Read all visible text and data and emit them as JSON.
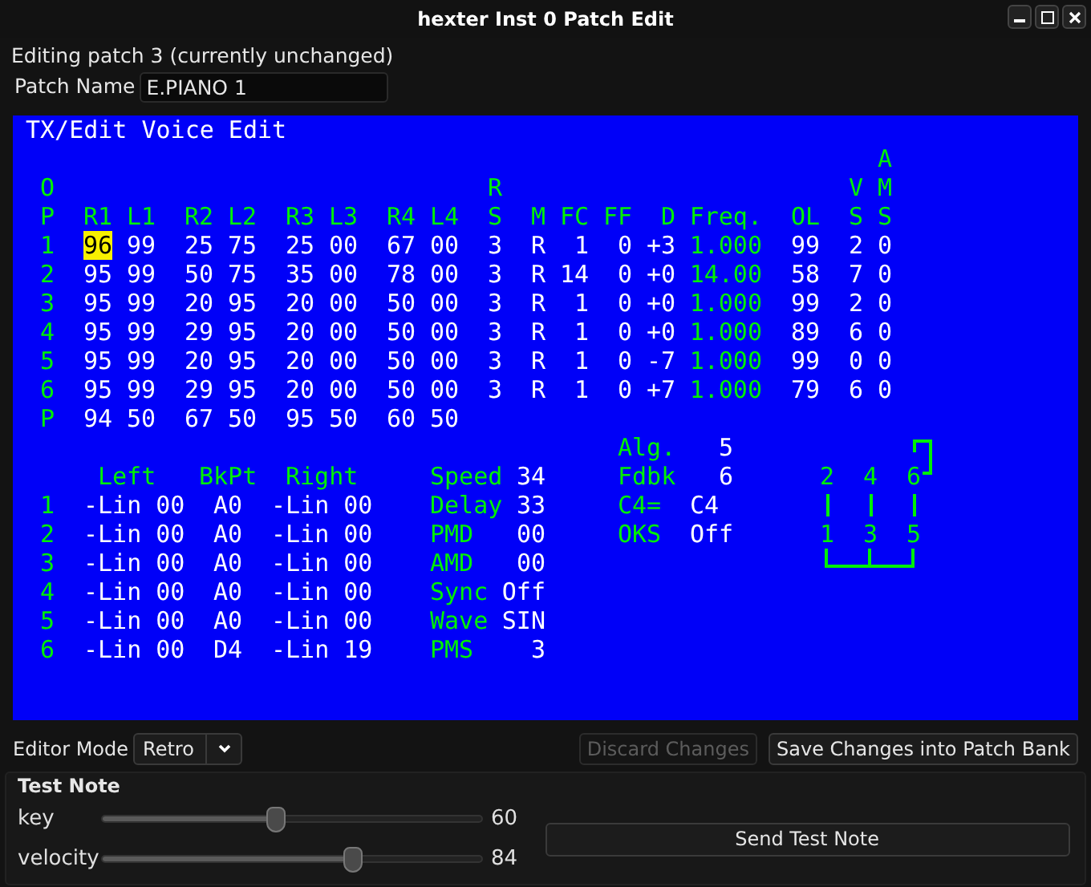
{
  "window": {
    "title": "hexter Inst 0 Patch Edit"
  },
  "status": "Editing patch 3 (currently unchanged)",
  "patch_name": {
    "label": "Patch Name",
    "value": "E.PIANO 1"
  },
  "voice_editor": {
    "title": "TX/Edit Voice Edit",
    "op_columns": [
      {
        "header": [
          "O",
          "P"
        ],
        "kind": "op"
      },
      {
        "header": [
          "R1"
        ],
        "kind": "param"
      },
      {
        "header": [
          "L1"
        ],
        "kind": "param"
      },
      {
        "header": [
          "R2"
        ],
        "kind": "param"
      },
      {
        "header": [
          "L2"
        ],
        "kind": "param"
      },
      {
        "header": [
          "R3"
        ],
        "kind": "param"
      },
      {
        "header": [
          "L3"
        ],
        "kind": "param"
      },
      {
        "header": [
          "R4"
        ],
        "kind": "param"
      },
      {
        "header": [
          "L4"
        ],
        "kind": "param"
      },
      {
        "header": [
          "R",
          "S"
        ],
        "kind": "param"
      },
      {
        "header": [
          "M"
        ],
        "kind": "param"
      },
      {
        "header": [
          "FC"
        ],
        "kind": "param"
      },
      {
        "header": [
          "FF"
        ],
        "kind": "param"
      },
      {
        "header": [
          "D"
        ],
        "kind": "param"
      },
      {
        "header": [
          "Freq."
        ],
        "kind": "freq"
      },
      {
        "header": [
          "OL"
        ],
        "kind": "param"
      },
      {
        "header": [
          "V",
          "S"
        ],
        "kind": "param"
      },
      {
        "header": [
          "A",
          "M",
          "S"
        ],
        "kind": "param"
      }
    ],
    "op_rows": [
      {
        "op": "1",
        "cells": [
          {
            "text": "96",
            "selected": true
          },
          {
            "text": "99",
            "selected": false
          },
          {
            "text": "25",
            "selected": false
          },
          {
            "text": "75",
            "selected": false
          },
          {
            "text": "25",
            "selected": false
          },
          {
            "text": "00",
            "selected": false
          },
          {
            "text": "67",
            "selected": false
          },
          {
            "text": "00",
            "selected": false
          },
          {
            "text": "3",
            "selected": false
          },
          {
            "text": "R",
            "selected": false
          },
          {
            "text": "1",
            "selected": false
          },
          {
            "text": "0",
            "selected": false
          },
          {
            "text": "+3",
            "selected": false
          },
          {
            "text": "1.000",
            "selected": false
          },
          {
            "text": "99",
            "selected": false
          },
          {
            "text": "2",
            "selected": false
          },
          {
            "text": "0",
            "selected": false
          }
        ]
      },
      {
        "op": "2",
        "cells": [
          {
            "text": "95",
            "selected": false
          },
          {
            "text": "99",
            "selected": false
          },
          {
            "text": "50",
            "selected": false
          },
          {
            "text": "75",
            "selected": false
          },
          {
            "text": "35",
            "selected": false
          },
          {
            "text": "00",
            "selected": false
          },
          {
            "text": "78",
            "selected": false
          },
          {
            "text": "00",
            "selected": false
          },
          {
            "text": "3",
            "selected": false
          },
          {
            "text": "R",
            "selected": false
          },
          {
            "text": "14",
            "selected": false
          },
          {
            "text": "0",
            "selected": false
          },
          {
            "text": "+0",
            "selected": false
          },
          {
            "text": "14.00",
            "selected": false
          },
          {
            "text": "58",
            "selected": false
          },
          {
            "text": "7",
            "selected": false
          },
          {
            "text": "0",
            "selected": false
          }
        ]
      },
      {
        "op": "3",
        "cells": [
          {
            "text": "95",
            "selected": false
          },
          {
            "text": "99",
            "selected": false
          },
          {
            "text": "20",
            "selected": false
          },
          {
            "text": "95",
            "selected": false
          },
          {
            "text": "20",
            "selected": false
          },
          {
            "text": "00",
            "selected": false
          },
          {
            "text": "50",
            "selected": false
          },
          {
            "text": "00",
            "selected": false
          },
          {
            "text": "3",
            "selected": false
          },
          {
            "text": "R",
            "selected": false
          },
          {
            "text": "1",
            "selected": false
          },
          {
            "text": "0",
            "selected": false
          },
          {
            "text": "+0",
            "selected": false
          },
          {
            "text": "1.000",
            "selected": false
          },
          {
            "text": "99",
            "selected": false
          },
          {
            "text": "2",
            "selected": false
          },
          {
            "text": "0",
            "selected": false
          }
        ]
      },
      {
        "op": "4",
        "cells": [
          {
            "text": "95",
            "selected": false
          },
          {
            "text": "99",
            "selected": false
          },
          {
            "text": "29",
            "selected": false
          },
          {
            "text": "95",
            "selected": false
          },
          {
            "text": "20",
            "selected": false
          },
          {
            "text": "00",
            "selected": false
          },
          {
            "text": "50",
            "selected": false
          },
          {
            "text": "00",
            "selected": false
          },
          {
            "text": "3",
            "selected": false
          },
          {
            "text": "R",
            "selected": false
          },
          {
            "text": "1",
            "selected": false
          },
          {
            "text": "0",
            "selected": false
          },
          {
            "text": "+0",
            "selected": false
          },
          {
            "text": "1.000",
            "selected": false
          },
          {
            "text": "89",
            "selected": false
          },
          {
            "text": "6",
            "selected": false
          },
          {
            "text": "0",
            "selected": false
          }
        ]
      },
      {
        "op": "5",
        "cells": [
          {
            "text": "95",
            "selected": false
          },
          {
            "text": "99",
            "selected": false
          },
          {
            "text": "20",
            "selected": false
          },
          {
            "text": "95",
            "selected": false
          },
          {
            "text": "20",
            "selected": false
          },
          {
            "text": "00",
            "selected": false
          },
          {
            "text": "50",
            "selected": false
          },
          {
            "text": "00",
            "selected": false
          },
          {
            "text": "3",
            "selected": false
          },
          {
            "text": "R",
            "selected": false
          },
          {
            "text": "1",
            "selected": false
          },
          {
            "text": "0",
            "selected": false
          },
          {
            "text": "-7",
            "selected": false
          },
          {
            "text": "1.000",
            "selected": false
          },
          {
            "text": "99",
            "selected": false
          },
          {
            "text": "0",
            "selected": false
          },
          {
            "text": "0",
            "selected": false
          }
        ]
      },
      {
        "op": "6",
        "cells": [
          {
            "text": "95",
            "selected": false
          },
          {
            "text": "99",
            "selected": false
          },
          {
            "text": "29",
            "selected": false
          },
          {
            "text": "95",
            "selected": false
          },
          {
            "text": "20",
            "selected": false
          },
          {
            "text": "00",
            "selected": false
          },
          {
            "text": "50",
            "selected": false
          },
          {
            "text": "00",
            "selected": false
          },
          {
            "text": "3",
            "selected": false
          },
          {
            "text": "R",
            "selected": false
          },
          {
            "text": "1",
            "selected": false
          },
          {
            "text": "0",
            "selected": false
          },
          {
            "text": "+7",
            "selected": false
          },
          {
            "text": "1.000",
            "selected": false
          },
          {
            "text": "79",
            "selected": false
          },
          {
            "text": "6",
            "selected": false
          },
          {
            "text": "0",
            "selected": false
          }
        ]
      }
    ],
    "pitch_eg": {
      "label": "P",
      "values": [
        "94",
        "50",
        "67",
        "50",
        "95",
        "50",
        "60",
        "50"
      ]
    },
    "globals": [
      {
        "label": "Alg.",
        "value": "5",
        "kind": "number"
      },
      {
        "label": "Fdbk",
        "value": "6",
        "kind": "number"
      },
      {
        "label": "C4=",
        "value": "C4",
        "kind": "text"
      },
      {
        "label": "OKS",
        "value": "Off",
        "kind": "text"
      }
    ],
    "scaling_headers": [
      "Left",
      "BkPt",
      "Right"
    ],
    "scaling_rows": [
      {
        "op": "1",
        "left": "-Lin 00",
        "breakpoint": "A0",
        "right": "-Lin 00"
      },
      {
        "op": "2",
        "left": "-Lin 00",
        "breakpoint": "A0",
        "right": "-Lin 00"
      },
      {
        "op": "3",
        "left": "-Lin 00",
        "breakpoint": "A0",
        "right": "-Lin 00"
      },
      {
        "op": "4",
        "left": "-Lin 00",
        "breakpoint": "A0",
        "right": "-Lin 00"
      },
      {
        "op": "5",
        "left": "-Lin 00",
        "breakpoint": "A0",
        "right": "-Lin 00"
      },
      {
        "op": "6",
        "left": "-Lin 00",
        "breakpoint": "D4",
        "right": "-Lin 19"
      }
    ],
    "lfo": [
      {
        "label": "Speed",
        "value": "34"
      },
      {
        "label": "Delay",
        "value": "33"
      },
      {
        "label": "PMD",
        "value": "00"
      },
      {
        "label": "AMD",
        "value": "00"
      },
      {
        "label": "Sync",
        "value": "Off"
      },
      {
        "label": "Wave",
        "value": "SIN"
      },
      {
        "label": "PMS",
        "value": "3"
      }
    ],
    "algorithm": {
      "modulators": [
        "2",
        "4",
        "6"
      ],
      "carriers": [
        "1",
        "3",
        "5"
      ],
      "feedback_loop": true
    }
  },
  "editor_mode": {
    "label": "Editor Mode",
    "value": "Retro"
  },
  "buttons": [
    {
      "label": "Discard Changes",
      "disabled": true
    },
    {
      "label": "Save Changes into Patch Bank",
      "disabled": false
    }
  ],
  "test_note": {
    "title": "Test Note",
    "sliders": [
      {
        "label": "key",
        "level": 0.46,
        "reading": "60"
      },
      {
        "label": "velocity",
        "level": 0.66,
        "reading": "84"
      }
    ],
    "send_button": "Send Test Note"
  }
}
